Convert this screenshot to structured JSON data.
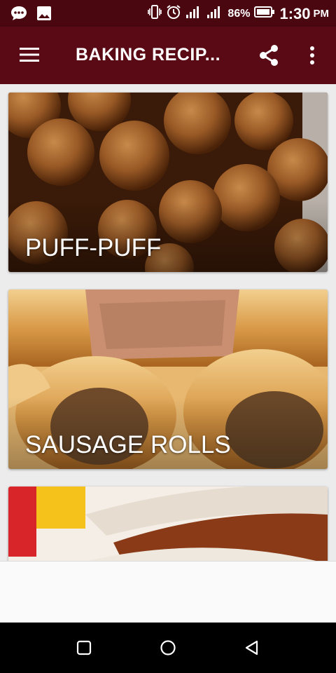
{
  "status_bar": {
    "battery_percent": "86%",
    "time": "1:30",
    "ampm": "PM"
  },
  "app_bar": {
    "title": "BAKING RECIP...",
    "icons": [
      "menu-icon",
      "share-icon",
      "more-vert-icon"
    ]
  },
  "recipes": [
    {
      "label": "PUFF-PUFF",
      "image": "puff-puff-photo"
    },
    {
      "label": "SAUSAGE ROLLS",
      "image": "sausage-rolls-photo"
    },
    {
      "label": "",
      "image": "third-recipe-photo"
    }
  ],
  "nav_bar": {
    "icons": [
      "recents-square-icon",
      "home-circle-icon",
      "back-triangle-icon"
    ]
  },
  "colors": {
    "status_bar": "#4a0710",
    "app_bar": "#5a0a14",
    "background": "#ececec"
  }
}
